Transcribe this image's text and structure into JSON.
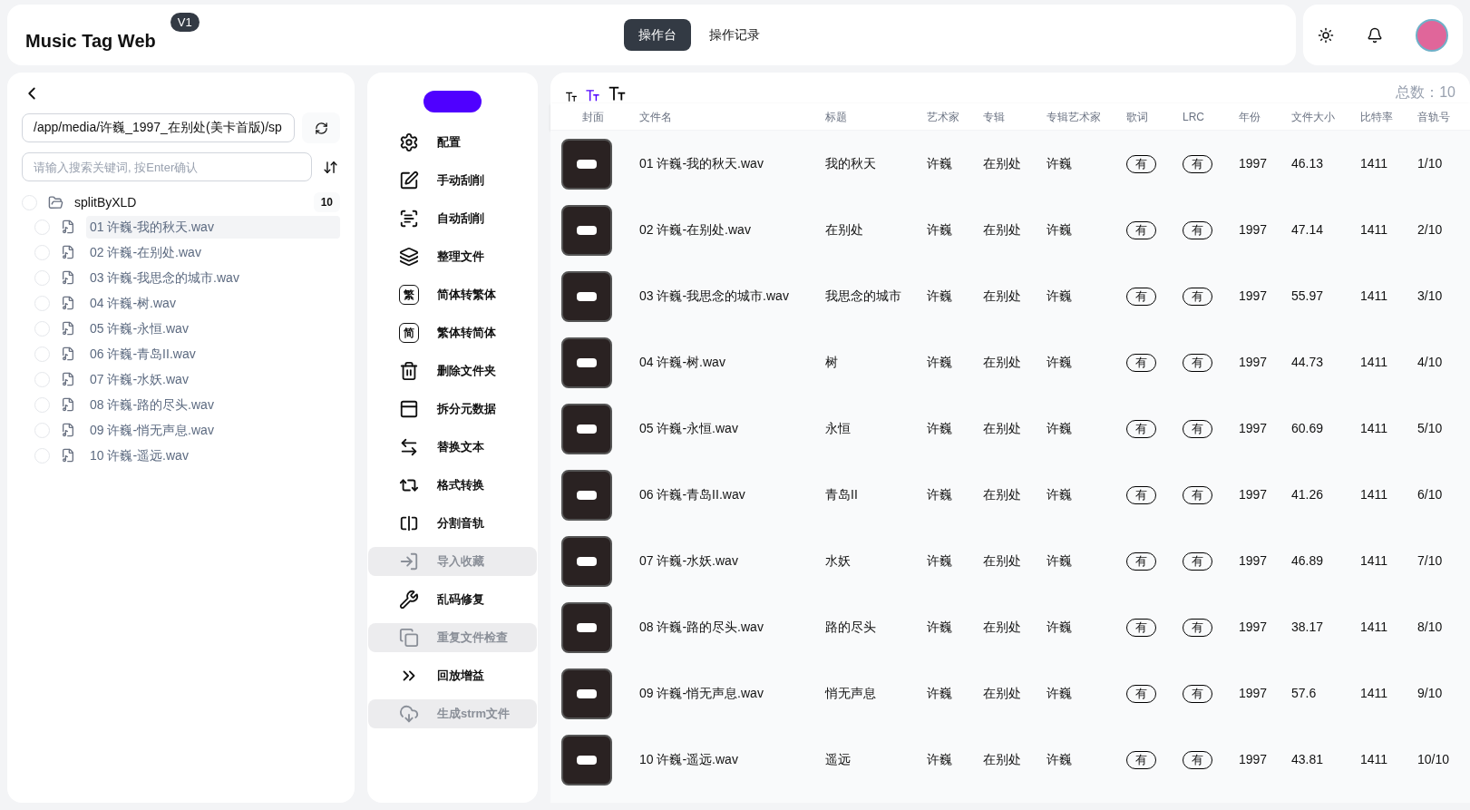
{
  "app": {
    "title": "Music Tag Web",
    "version": "V1"
  },
  "nav_tabs": [
    {
      "label": "操作台",
      "selected": true
    },
    {
      "label": "操作记录",
      "selected": false
    }
  ],
  "file_panel": {
    "path": "/app/media/许巍_1997_在别处(美卡首版)/sp",
    "search_placeholder": "请输入搜索关键词, 按Enter确认",
    "tree": [
      {
        "label": "splitByXLD",
        "count": "10",
        "checked": false,
        "children": [
          {
            "label": "01 许巍-我的秋天.wav",
            "checked": false,
            "selected": true
          },
          {
            "label": "02 许巍-在别处.wav",
            "checked": false,
            "selected": false
          },
          {
            "label": "03 许巍-我思念的城市.wav",
            "checked": false,
            "selected": false
          },
          {
            "label": "04 许巍-树.wav",
            "checked": false,
            "selected": false
          },
          {
            "label": "05 许巍-永恒.wav",
            "checked": false,
            "selected": false
          },
          {
            "label": "06 许巍-青岛II.wav",
            "checked": false,
            "selected": false
          },
          {
            "label": "07 许巍-水妖.wav",
            "checked": false,
            "selected": false
          },
          {
            "label": "08 许巍-路的尽头.wav",
            "checked": false,
            "selected": false
          },
          {
            "label": "09 许巍-悄无声息.wav",
            "checked": false,
            "selected": false
          },
          {
            "label": "10 许巍-遥远.wav",
            "checked": false,
            "selected": false
          }
        ]
      }
    ]
  },
  "actions": [
    {
      "label": "配置",
      "disabled": false
    },
    {
      "label": "手动刮削",
      "disabled": false
    },
    {
      "label": "自动刮削",
      "disabled": false
    },
    {
      "label": "整理文件",
      "disabled": false
    },
    {
      "label": "简体转繁体",
      "glyph": "繁",
      "disabled": false
    },
    {
      "label": "繁体转简体",
      "glyph": "简",
      "disabled": false
    },
    {
      "label": "删除文件夹",
      "disabled": false
    },
    {
      "label": "拆分元数据",
      "disabled": false
    },
    {
      "label": "替换文本",
      "disabled": false
    },
    {
      "label": "格式转换",
      "disabled": false
    },
    {
      "label": "分割音轨",
      "disabled": false
    },
    {
      "label": "导入收藏",
      "disabled": true
    },
    {
      "label": "乱码修复",
      "disabled": false
    },
    {
      "label": "重复文件检查",
      "disabled": true
    },
    {
      "label": "回放增益",
      "disabled": false
    },
    {
      "label": "生成strm文件",
      "disabled": true
    }
  ],
  "table": {
    "font_sizes": [
      {
        "kind": "small",
        "selected": false
      },
      {
        "kind": "medium",
        "selected": true
      },
      {
        "kind": "large",
        "selected": false
      }
    ],
    "total": "总数：10",
    "columns": [
      "封面",
      "文件名",
      "标题",
      "艺术家",
      "专辑",
      "专辑艺术家",
      "歌词",
      "LRC",
      "年份",
      "文件大小",
      "比特率",
      "音轨号"
    ],
    "rows": [
      {
        "file": "01 许巍-我的秋天.wav",
        "title": "我的秋天",
        "artist": "许巍",
        "album": "在别处",
        "album_artist": "许巍",
        "lyrics": "有",
        "lrc": "有",
        "year": "1997",
        "size": "46.13",
        "bitrate": "1411",
        "track": "1/10"
      },
      {
        "file": "02 许巍-在别处.wav",
        "title": "在别处",
        "artist": "许巍",
        "album": "在别处",
        "album_artist": "许巍",
        "lyrics": "有",
        "lrc": "有",
        "year": "1997",
        "size": "47.14",
        "bitrate": "1411",
        "track": "2/10"
      },
      {
        "file": "03 许巍-我思念的城市.wav",
        "title": "我思念的城市",
        "artist": "许巍",
        "album": "在别处",
        "album_artist": "许巍",
        "lyrics": "有",
        "lrc": "有",
        "year": "1997",
        "size": "55.97",
        "bitrate": "1411",
        "track": "3/10"
      },
      {
        "file": "04 许巍-树.wav",
        "title": "树",
        "artist": "许巍",
        "album": "在别处",
        "album_artist": "许巍",
        "lyrics": "有",
        "lrc": "有",
        "year": "1997",
        "size": "44.73",
        "bitrate": "1411",
        "track": "4/10"
      },
      {
        "file": "05 许巍-永恒.wav",
        "title": "永恒",
        "artist": "许巍",
        "album": "在别处",
        "album_artist": "许巍",
        "lyrics": "有",
        "lrc": "有",
        "year": "1997",
        "size": "60.69",
        "bitrate": "1411",
        "track": "5/10"
      },
      {
        "file": "06 许巍-青岛II.wav",
        "title": "青岛II",
        "artist": "许巍",
        "album": "在别处",
        "album_artist": "许巍",
        "lyrics": "有",
        "lrc": "有",
        "year": "1997",
        "size": "41.26",
        "bitrate": "1411",
        "track": "6/10"
      },
      {
        "file": "07 许巍-水妖.wav",
        "title": "水妖",
        "artist": "许巍",
        "album": "在别处",
        "album_artist": "许巍",
        "lyrics": "有",
        "lrc": "有",
        "year": "1997",
        "size": "46.89",
        "bitrate": "1411",
        "track": "7/10"
      },
      {
        "file": "08 许巍-路的尽头.wav",
        "title": "路的尽头",
        "artist": "许巍",
        "album": "在别处",
        "album_artist": "许巍",
        "lyrics": "有",
        "lrc": "有",
        "year": "1997",
        "size": "38.17",
        "bitrate": "1411",
        "track": "8/10"
      },
      {
        "file": "09 许巍-悄无声息.wav",
        "title": "悄无声息",
        "artist": "许巍",
        "album": "在别处",
        "album_artist": "许巍",
        "lyrics": "有",
        "lrc": "有",
        "year": "1997",
        "size": "57.6",
        "bitrate": "1411",
        "track": "9/10"
      },
      {
        "file": "10 许巍-遥远.wav",
        "title": "遥远",
        "artist": "许巍",
        "album": "在别处",
        "album_artist": "许巍",
        "lyrics": "有",
        "lrc": "有",
        "year": "1997",
        "size": "43.81",
        "bitrate": "1411",
        "track": "10/10"
      }
    ]
  }
}
